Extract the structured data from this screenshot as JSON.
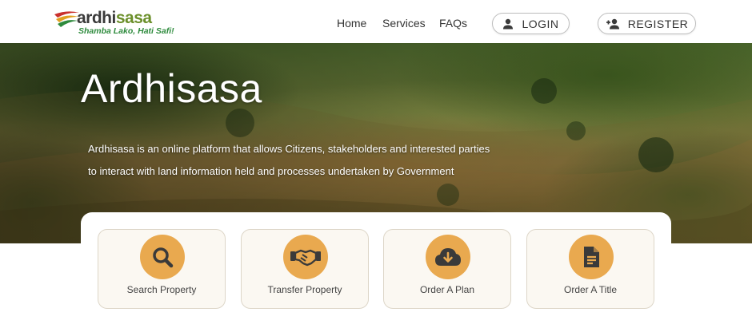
{
  "header": {
    "logo": {
      "name_part1": "ardhi",
      "name_part2": "sasa",
      "tagline": "Shamba Lako, Hati Safi!"
    },
    "nav": [
      {
        "label": "Home",
        "icon": ""
      },
      {
        "label": "Services",
        "icon": ""
      },
      {
        "label": "FAQs",
        "icon": ""
      }
    ],
    "login": {
      "label": "LOGIN",
      "icon": "user-icon"
    },
    "register": {
      "label": "REGISTER",
      "icon": "user-plus-icon"
    }
  },
  "hero": {
    "title": "Ardhisasa",
    "description_line1": "Ardhisasa is an online platform that allows Citizens, stakeholders and interested parties",
    "description_line2": "to interact with land information held and processes undertaken by Government"
  },
  "services": [
    {
      "label": "Search Property",
      "icon": "search-icon"
    },
    {
      "label": "Transfer Property",
      "icon": "handshake-icon"
    },
    {
      "label": "Order A Plan",
      "icon": "cloud-download-icon"
    },
    {
      "label": "Order A Title",
      "icon": "document-icon"
    }
  ],
  "colors": {
    "accent": "#e9a94f",
    "card_bg": "#fbf8f2",
    "brand_green": "#6b8f2a",
    "tagline_green": "#2e8b3d"
  }
}
